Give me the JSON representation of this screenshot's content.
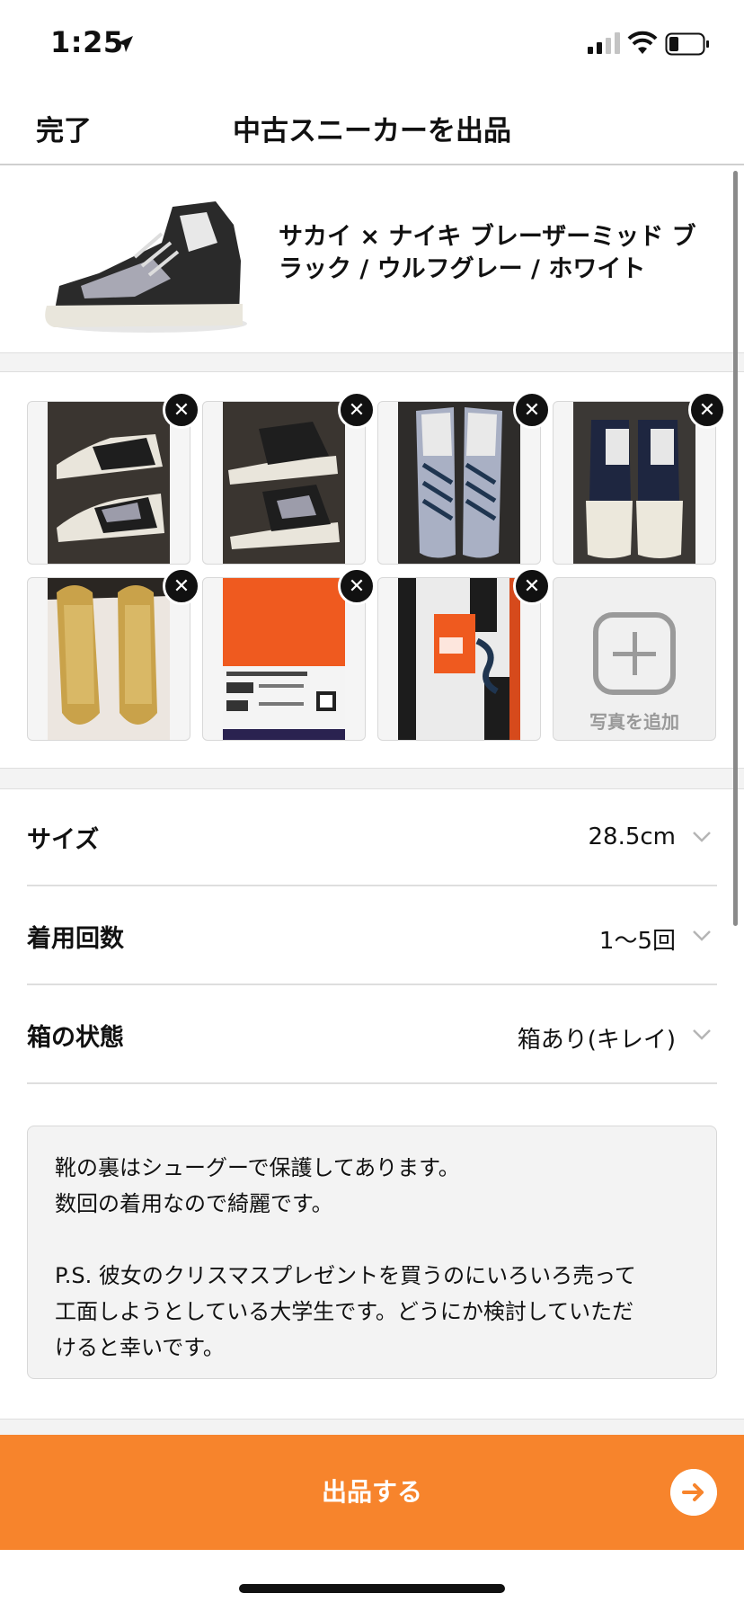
{
  "status_bar": {
    "time": "1:25",
    "signal_icon": "cellular-signal-icon",
    "wifi_icon": "wifi-icon",
    "battery_icon": "battery-icon"
  },
  "nav": {
    "done_label": "完了",
    "title": "中古スニーカーを出品"
  },
  "product": {
    "name": "サカイ × ナイキ ブレーザーミッド ブラック / ウルフグレー / ホワイト",
    "image_icon": "sneaker-image"
  },
  "photos": {
    "items": [
      {
        "label": "photo-1"
      },
      {
        "label": "photo-2"
      },
      {
        "label": "photo-3"
      },
      {
        "label": "photo-4"
      },
      {
        "label": "photo-5"
      },
      {
        "label": "photo-6"
      },
      {
        "label": "photo-7"
      }
    ],
    "delete_glyph": "✕",
    "add_label": "写真を追加"
  },
  "fields": {
    "size": {
      "label": "サイズ",
      "value": "28.5cm"
    },
    "wear_count": {
      "label": "着用回数",
      "value": "1〜5回"
    },
    "box_condition": {
      "label": "箱の状態",
      "value": "箱あり(キレイ)"
    }
  },
  "description": {
    "text": "靴の裏はシューグーで保護してあります。\n数回の着用なので綺麗です。\n\nP.S. 彼女のクリスマスプレゼントを買うのにいろいろ売って\n工面しようとしている大学生です。どうにか検討していただ\nけると幸いです。"
  },
  "submit": {
    "label": "出品する",
    "color": "#f7842c"
  }
}
